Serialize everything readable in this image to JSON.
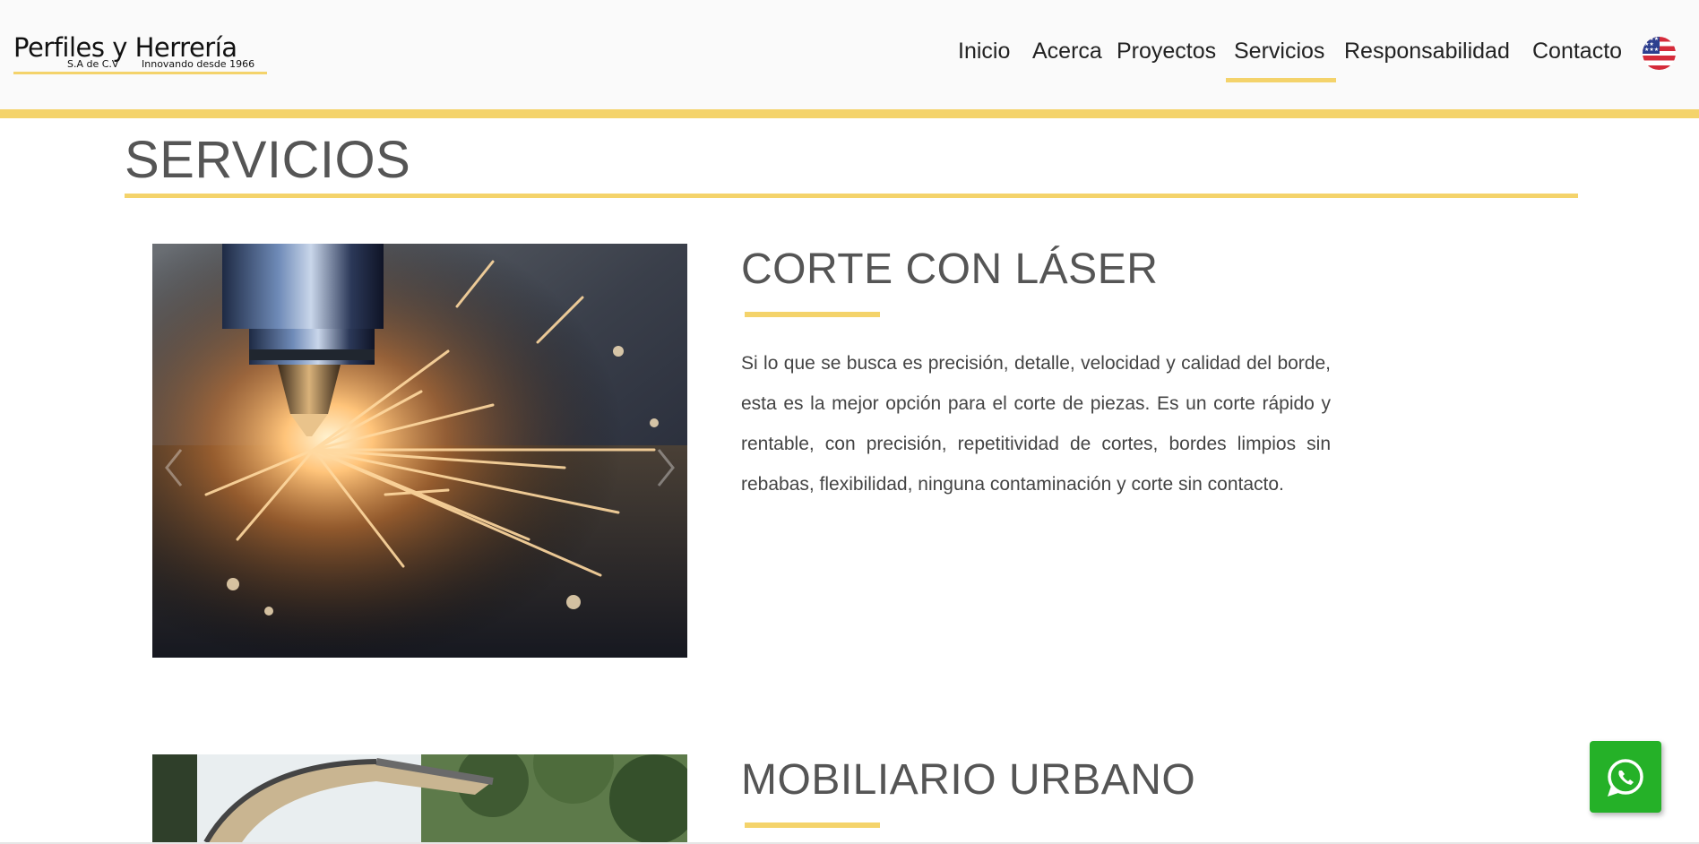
{
  "brand": {
    "name": "Perfiles y Herrería",
    "legal": "S.A de C.V",
    "tagline": "Innovando desde 1966",
    "accent_color": "#f4d36b",
    "text_color": "#555555"
  },
  "nav": {
    "items": [
      {
        "label": "Inicio",
        "active": false
      },
      {
        "label": "Acerca",
        "active": false
      },
      {
        "label": "Proyectos",
        "active": false
      },
      {
        "label": "Servicios",
        "active": true
      },
      {
        "label": "Responsabilidad",
        "active": false
      },
      {
        "label": "Contacto",
        "active": false
      }
    ],
    "language_icon": "us-flag-icon"
  },
  "page": {
    "title": "SERVICIOS"
  },
  "services": [
    {
      "title": "CORTE CON LÁSER",
      "description": "Si lo que se busca es precisión, detalle, velocidad y calidad del borde, esta es la mejor opción para el corte de piezas. Es un corte rápido y rentable, con precisión, repetitividad de cortes, bordes limpios sin rebabas, flexibilidad, ninguna contaminación y corte sin contacto.",
      "image": "laser-cutting-photo"
    },
    {
      "title": "MOBILIARIO URBANO",
      "description": "",
      "image": "urban-furniture-photo"
    }
  ],
  "floating": {
    "whatsapp_icon": "whatsapp-icon",
    "whatsapp_color": "#25b128"
  }
}
